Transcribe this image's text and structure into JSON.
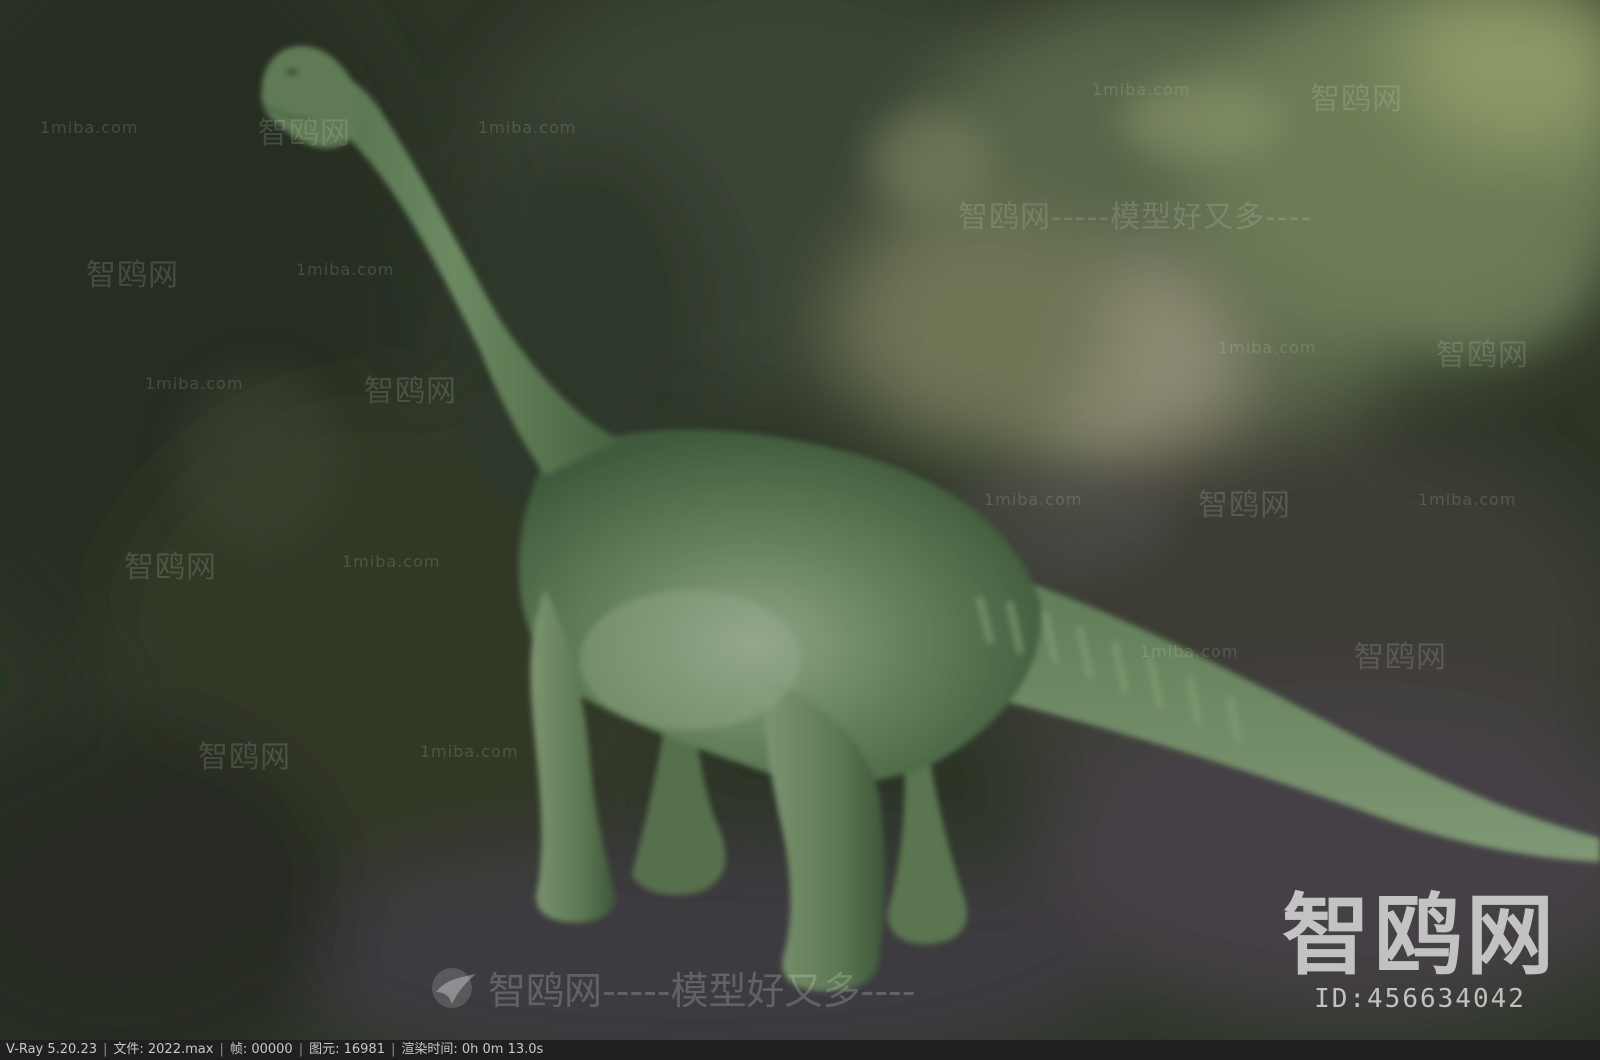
{
  "status_bar": {
    "renderer": "V-Ray 5.20.23",
    "file": "文件: 2022.max",
    "frame": "帧: 00000",
    "primitives": "图元: 16981",
    "render_time": "渲染时间:  0h  0m 13.0s"
  },
  "watermark": {
    "brand": "智鸥网",
    "slogan": "智鸥网-----模型好又多----",
    "site": "1miba.com",
    "id": "ID:456634042"
  },
  "colors": {
    "background_dark": "#2c3326",
    "dinosaur_green": "#5f7a56",
    "status_bar": "#1f2020"
  }
}
